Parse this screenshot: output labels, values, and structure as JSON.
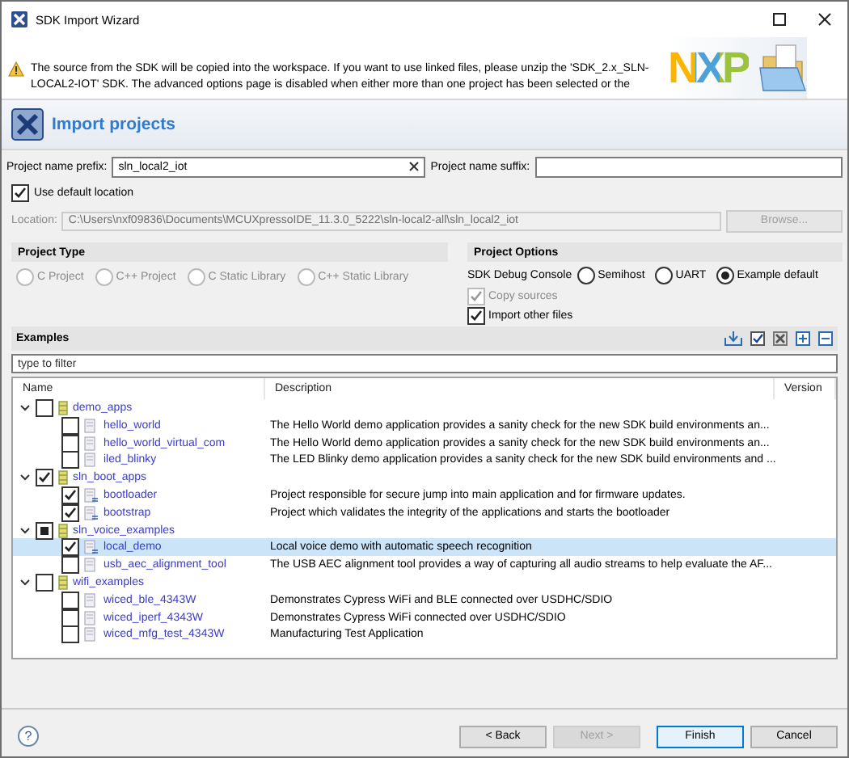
{
  "window": {
    "title": "SDK Import Wizard"
  },
  "message": {
    "kind": "warning",
    "text": "The source from the SDK will be copied into the workspace. If you want to use linked files, please unzip the 'SDK_2.x_SLN-LOCAL2-IOT' SDK. The advanced options page is disabled when either more than one project has been selected or the"
  },
  "logo": {
    "text": "NXP"
  },
  "header": {
    "title": "Import projects"
  },
  "prefix": {
    "label": "Project name prefix:",
    "value": "sln_local2_iot"
  },
  "suffix": {
    "label": "Project name suffix:"
  },
  "use_default_location": {
    "label": "Use default location",
    "checked": true
  },
  "location": {
    "label": "Location:",
    "value": "C:\\Users\\nxf09836\\Documents\\MCUXpressoIDE_11.3.0_5222\\sln-local2-all\\sln_local2_iot",
    "disabled": true
  },
  "browse": {
    "label": "Browse...",
    "disabled": true
  },
  "project_type": {
    "title": "Project Type",
    "options": [
      {
        "label": "C Project",
        "selected": false,
        "disabled": true
      },
      {
        "label": "C++ Project",
        "selected": false,
        "disabled": true
      },
      {
        "label": "C Static Library",
        "selected": false,
        "disabled": true
      },
      {
        "label": "C++ Static Library",
        "selected": false,
        "disabled": true
      }
    ]
  },
  "project_options": {
    "title": "Project Options",
    "console_label": "SDK Debug Console",
    "console_options": [
      {
        "label": "Semihost",
        "selected": false
      },
      {
        "label": "UART",
        "selected": false
      },
      {
        "label": "Example default",
        "selected": true
      }
    ],
    "checkboxes": [
      {
        "label": "Copy sources",
        "checked": true,
        "disabled": true
      },
      {
        "label": "Import other files",
        "checked": true,
        "disabled": false
      }
    ]
  },
  "examples": {
    "title": "Examples",
    "filter_placeholder": "type to filter",
    "columns": [
      "Name",
      "Description",
      "Version"
    ],
    "rows": [
      {
        "name": "demo_apps",
        "checked": false,
        "partial": false,
        "expanded": true,
        "selected": false,
        "children": [
          {
            "name": "hello_world",
            "checked": false,
            "selected": false,
            "description": "The Hello World demo application provides a sanity check for the new SDK build environments an..."
          },
          {
            "name": "hello_world_virtual_com",
            "checked": false,
            "selected": false,
            "description": "The Hello World demo application provides a sanity check for the new SDK build environments an..."
          },
          {
            "name": "iled_blinky",
            "checked": false,
            "selected": false,
            "description": "The LED Blinky demo application provides a sanity check for the new SDK build environments and ..."
          }
        ]
      },
      {
        "name": "sln_boot_apps",
        "checked": true,
        "partial": false,
        "expanded": true,
        "selected": false,
        "children": [
          {
            "name": "bootloader",
            "checked": true,
            "selected": false,
            "description": "Project responsible for secure jump into main application and for firmware updates."
          },
          {
            "name": "bootstrap",
            "checked": true,
            "selected": false,
            "description": "Project which validates the integrity of the applications and starts the bootloader"
          }
        ]
      },
      {
        "name": "sln_voice_examples",
        "checked": false,
        "partial": true,
        "expanded": true,
        "selected": false,
        "children": [
          {
            "name": "local_demo",
            "checked": true,
            "selected": true,
            "description": "Local voice demo with automatic speech recognition"
          },
          {
            "name": "usb_aec_alignment_tool",
            "checked": false,
            "selected": false,
            "description": "The USB AEC alignment tool provides a way of capturing all audio streams to help evaluate the AF..."
          }
        ]
      },
      {
        "name": "wifi_examples",
        "checked": false,
        "partial": false,
        "expanded": true,
        "selected": false,
        "children": [
          {
            "name": "wiced_ble_4343W",
            "checked": false,
            "selected": false,
            "description": "Demonstrates Cypress WiFi and BLE connected over USDHC/SDIO"
          },
          {
            "name": "wiced_iperf_4343W",
            "checked": false,
            "selected": false,
            "description": "Demonstrates Cypress WiFi connected over USDHC/SDIO"
          },
          {
            "name": "wiced_mfg_test_4343W",
            "checked": false,
            "selected": false,
            "description": "Manufacturing Test Application"
          }
        ]
      }
    ]
  },
  "help": {
    "text": "?"
  },
  "buttons": [
    {
      "label": "< Back",
      "disabled": false,
      "default": false
    },
    {
      "label": "Next >",
      "disabled": true,
      "default": false
    },
    {
      "label": "Finish",
      "disabled": false,
      "default": true
    },
    {
      "label": "Cancel",
      "disabled": false,
      "default": false
    }
  ]
}
